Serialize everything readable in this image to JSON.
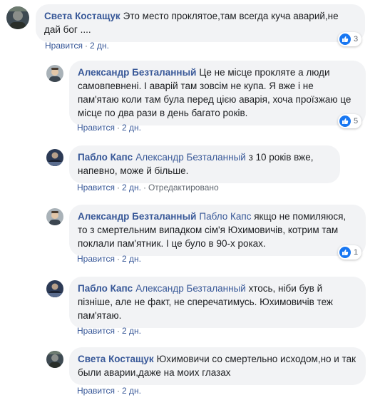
{
  "comments": [
    {
      "author": "Света Костащук",
      "mention": "",
      "text": "Это место проклятое,там всегда куча аварий,не дай бог ....",
      "like_label": "Нравится",
      "time": "2 дн.",
      "edited": "",
      "reactions": "3"
    },
    {
      "author": "Александр Безталанный",
      "mention": "",
      "text": "Це не місце прокляте а люди самовпевнені. І аварій там зовсім не купа. Я вже і не пам'ятаю коли там була перед цією аварія, хоча проїзжаю це місце по два рази в день багато років.",
      "like_label": "Нравится",
      "time": "2 дн.",
      "edited": "",
      "reactions": "5"
    },
    {
      "author": "Пабло Капс",
      "mention": "Александр Безталанный",
      "text": "з 10 років вже, напевно, може й більше.",
      "like_label": "Нравится",
      "time": "2 дн.",
      "edited": "Отредактировано",
      "reactions": ""
    },
    {
      "author": "Александр Безталанный",
      "mention": "Пабло Капс",
      "text": "якщо не помиляюся, то з смертельним випадком сім'я Юхимовичів, котрим там поклали пам'ятник. І це було в 90-х роках.",
      "like_label": "Нравится",
      "time": "2 дн.",
      "edited": "",
      "reactions": "1"
    },
    {
      "author": "Пабло Капс",
      "mention": "Александр Безталанный",
      "text": "хтось, ніби був й пізніше, але не факт, не сперечатимусь. Юхимовичів теж пам'ятаю.",
      "like_label": "Нравится",
      "time": "2 дн.",
      "edited": "",
      "reactions": ""
    },
    {
      "author": "Света Костащук",
      "mention": "",
      "text": "Юхимовичи со смертельно исходом,но и так были аварии,даже на моих глазах",
      "like_label": "Нравится",
      "time": "2 дн.",
      "edited": "",
      "reactions": ""
    }
  ],
  "colors": {
    "link": "#385898",
    "bubble": "#f2f3f5",
    "meta": "#606770",
    "like": "#1877f2"
  },
  "icons": [
    "avatar",
    "like-icon"
  ]
}
